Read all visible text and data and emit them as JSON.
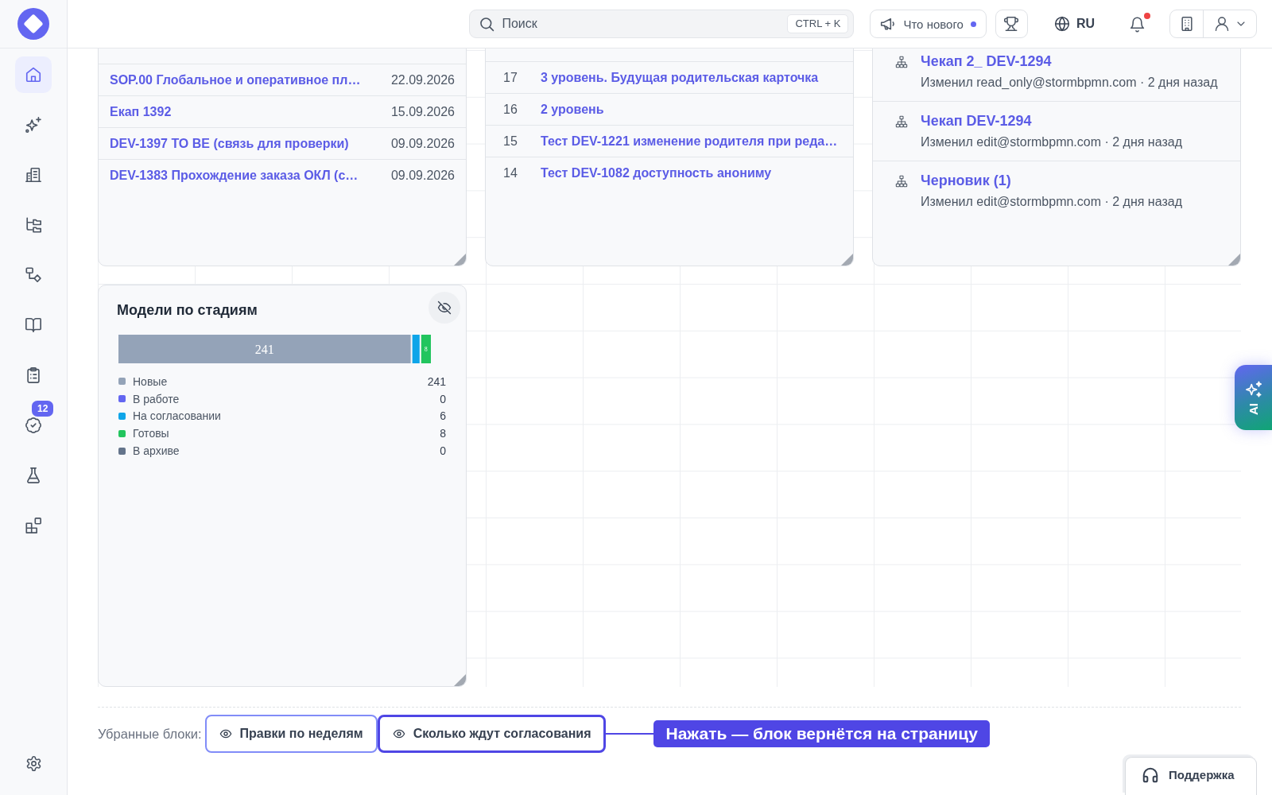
{
  "sidebar": {
    "items": [
      {
        "selected": true
      },
      {
        "selected": false
      },
      {
        "selected": false
      },
      {
        "selected": false
      },
      {
        "selected": false
      },
      {
        "selected": false
      },
      {
        "selected": false
      },
      {
        "selected": false,
        "badge": "12"
      },
      {
        "selected": false
      },
      {
        "selected": false
      }
    ],
    "settings": {
      "selected": false
    }
  },
  "header": {
    "search": {
      "placeholder": "Поиск",
      "shortcut": "CTRL + K"
    },
    "whats_new": {
      "label": "Что нового",
      "unread": true
    },
    "language": "RU",
    "notifications": {
      "unread": true
    }
  },
  "cards": [
    {
      "kind": "dated",
      "rows": [
        {
          "title": "SOP.00 Глобальное и оперативное пл…",
          "date": "22.09.2026"
        },
        {
          "title": "Екап 1392",
          "date": "15.09.2026"
        },
        {
          "title": "DEV-1397 TO BE (связь для проверки)",
          "date": "09.09.2026"
        },
        {
          "title": "DEV-1383 Прохождение заказа ОКЛ (с…",
          "date": "09.09.2026"
        }
      ]
    },
    {
      "kind": "numbered",
      "rows": [
        {
          "number": "17",
          "title": "3 уровень. Будущая родительская карточка"
        },
        {
          "number": "16",
          "title": "2 уровень"
        },
        {
          "number": "15",
          "title": "Тест DEV-1221 изменение родителя при реда…"
        },
        {
          "number": "14",
          "title": "Тест DEV-1082 доступность анониму"
        }
      ]
    },
    {
      "kind": "changes",
      "items": [
        {
          "title": "Чекап 2_ DEV-1294",
          "meta": "Изменил read_only@stormbpmn.com · 2 дня назад"
        },
        {
          "title": "Чекап DEV-1294",
          "meta": "Изменил edit@stormbpmn.com · 2 дня назад"
        },
        {
          "title": "Черновик (1)",
          "meta": "Изменил edit@stormbpmn.com · 2 дня назад"
        }
      ]
    }
  ],
  "stages_card": {
    "title": "Модели по стадиям",
    "stages": [
      {
        "label": "Новые",
        "count": "241",
        "color": "#94a3b8",
        "bar_label": "241"
      },
      {
        "label": "В работе",
        "count": "0",
        "color": "#6366f1"
      },
      {
        "label": "На согласовании",
        "count": "6",
        "color": "#0ea5e9"
      },
      {
        "label": "Готовы",
        "count": "8",
        "color": "#22c55e",
        "bar_label": "8"
      },
      {
        "label": "В архиве",
        "count": "0",
        "color": "#64748b"
      }
    ]
  },
  "removed_blocks": {
    "label": "Убранные блоки:",
    "blocks": [
      {
        "label": "Правки по неделям",
        "highlighted": false
      },
      {
        "label": "Сколько ждут согласования",
        "highlighted": true
      }
    ],
    "callout": "Нажать — блок вернётся на страницу"
  },
  "ai_button": {
    "label": "AI"
  },
  "support_button": {
    "label": "Поддержка"
  }
}
